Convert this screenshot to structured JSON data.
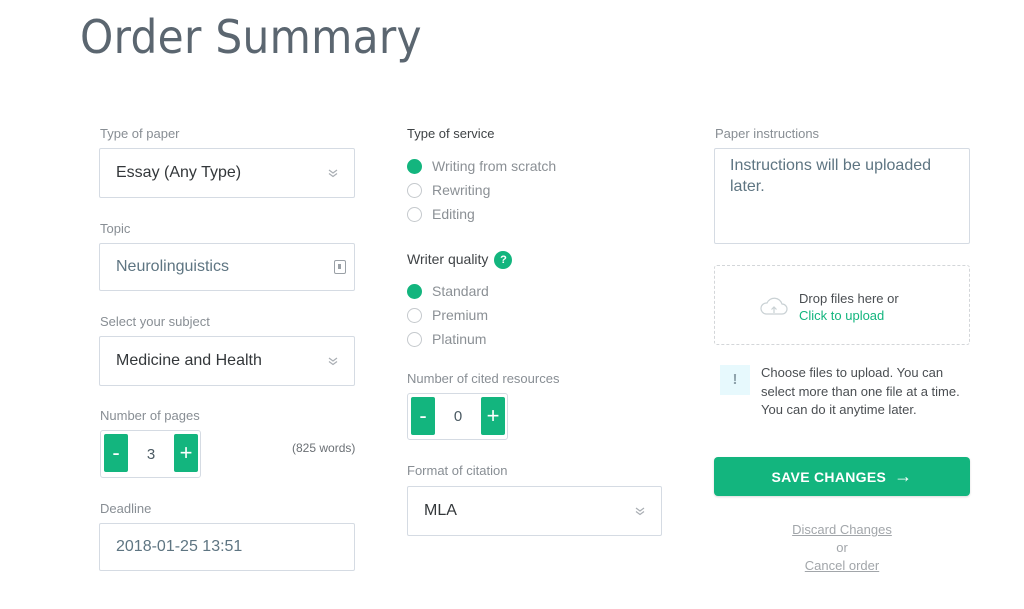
{
  "page": {
    "title": "Order Summary"
  },
  "left": {
    "type_of_paper": {
      "label": "Type of paper",
      "value": "Essay (Any Type)",
      "icon": "chevron-double-down-icon"
    },
    "topic": {
      "label": "Topic",
      "value": "Neurolinguistics",
      "icon": "document-icon"
    },
    "subject": {
      "label": "Select your subject",
      "value": "Medicine and Health",
      "icon": "chevron-double-down-icon"
    },
    "pages": {
      "label": "Number of pages",
      "minus": "-",
      "value": "3",
      "plus": "+",
      "words": "(825 words)"
    },
    "deadline": {
      "label": "Deadline",
      "value": "2018-01-25 13:51"
    }
  },
  "middle": {
    "service": {
      "label": "Type of service",
      "options": [
        {
          "label": "Writing from scratch",
          "selected": true
        },
        {
          "label": "Rewriting",
          "selected": false
        },
        {
          "label": "Editing",
          "selected": false
        }
      ]
    },
    "quality": {
      "label": "Writer quality",
      "help": "?",
      "options": [
        {
          "label": "Standard",
          "selected": true
        },
        {
          "label": "Premium",
          "selected": false
        },
        {
          "label": "Platinum",
          "selected": false
        }
      ]
    },
    "sources": {
      "label": "Number of cited resources",
      "minus": "-",
      "value": "0",
      "plus": "+"
    },
    "citation": {
      "label": "Format of citation",
      "value": "MLA",
      "icon": "chevron-double-down-icon"
    }
  },
  "right": {
    "instructions": {
      "label": "Paper instructions",
      "value": "Instructions will be uploaded later."
    },
    "upload": {
      "text": "Drop files here or",
      "link": "Click to upload",
      "icon": "cloud-upload-icon"
    },
    "info": {
      "icon": "!",
      "text": "Choose files to upload. You can select more than one file at a time. You can do it anytime later."
    },
    "save": {
      "label": "SAVE CHANGES",
      "arrow": "→"
    },
    "discard": "Discard Changes",
    "or": "or",
    "cancel": "Cancel order"
  },
  "colors": {
    "accent": "#13b57e",
    "border": "#d5dbe3",
    "info_bg": "#e7f9fd"
  }
}
